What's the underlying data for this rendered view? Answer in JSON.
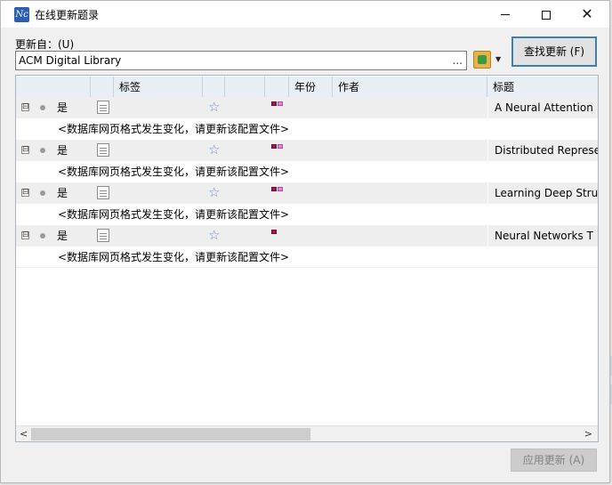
{
  "window": {
    "title": "在线更新题录",
    "app_icon_text": "Nc",
    "minimize_glyph": "",
    "maximize_glyph": "",
    "close_glyph": "✕"
  },
  "update_from": {
    "label": "更新自：(U)",
    "value": "ACM Digital Library",
    "ellipsis": "...",
    "dropdown_arrow": "▼"
  },
  "find_button_label": "查找更新 (F)",
  "grid": {
    "columns": [
      "",
      "",
      "标签",
      "",
      "",
      "",
      "年份",
      "作者",
      "标题"
    ],
    "rows": [
      {
        "expander": "⊟",
        "status": "是",
        "star": "☆",
        "flags": 2,
        "title": "A Neural Attention",
        "message": "<数据库网页格式发生变化，请更新该配置文件>"
      },
      {
        "expander": "⊟",
        "status": "是",
        "star": "☆",
        "flags": 2,
        "title": "Distributed Represe",
        "message": "<数据库网页格式发生变化，请更新该配置文件>"
      },
      {
        "expander": "⊟",
        "status": "是",
        "star": "☆",
        "flags": 2,
        "title": "Learning Deep Stru",
        "message": "<数据库网页格式发生变化，请更新该配置文件>"
      },
      {
        "expander": "⊟",
        "status": "是",
        "star": "☆",
        "flags": 1,
        "title": "Neural Networks T",
        "message": "<数据库网页格式发生变化，请更新该配置文件>"
      }
    ],
    "scroll_left": "<",
    "scroll_right": ">"
  },
  "apply_button_label": "应用更新 (A)",
  "colors": {
    "flag_red": "#b0124a",
    "flag_pink": "#d68cd6",
    "accent_border": "#3c7fb1",
    "star": "#6b8fc7"
  }
}
